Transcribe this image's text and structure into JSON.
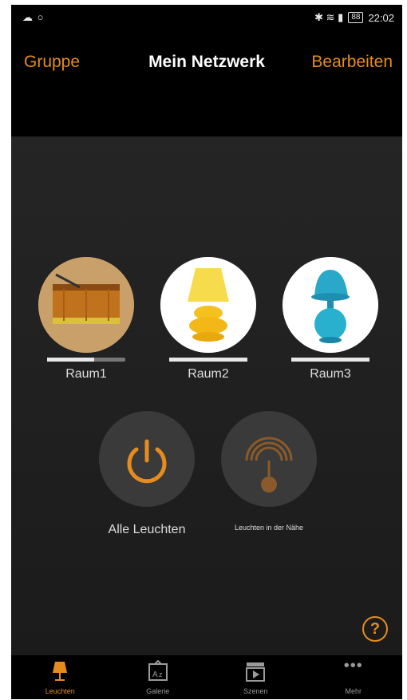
{
  "status_bar": {
    "left_icons": "☁ ○",
    "right_icons": "✱ ≋ ▮",
    "battery": "88",
    "time": "22:02"
  },
  "header": {
    "left_action": "Gruppe",
    "title": "Mein Netzwerk",
    "right_action": "Bearbeiten"
  },
  "rooms": [
    {
      "label": "Raum1",
      "brightness": 0.6
    },
    {
      "label": "Raum2",
      "brightness": 1.0
    },
    {
      "label": "Raum3",
      "brightness": 1.0
    }
  ],
  "actions": {
    "all_lights_label": "Alle Leuchten",
    "nearby_label": "Leuchten in der Nähe"
  },
  "tabs": [
    {
      "label": "Leuchten",
      "icon": "lamp-icon",
      "active": true
    },
    {
      "label": "Galerie",
      "icon": "gallery-icon",
      "active": false
    },
    {
      "label": "Szenen",
      "icon": "scenes-icon",
      "active": false
    },
    {
      "label": "Mehr",
      "icon": "more-icon",
      "active": false
    }
  ],
  "colors": {
    "accent": "#e58c1f",
    "background": "#1e1e1e",
    "topbar": "#000000"
  }
}
